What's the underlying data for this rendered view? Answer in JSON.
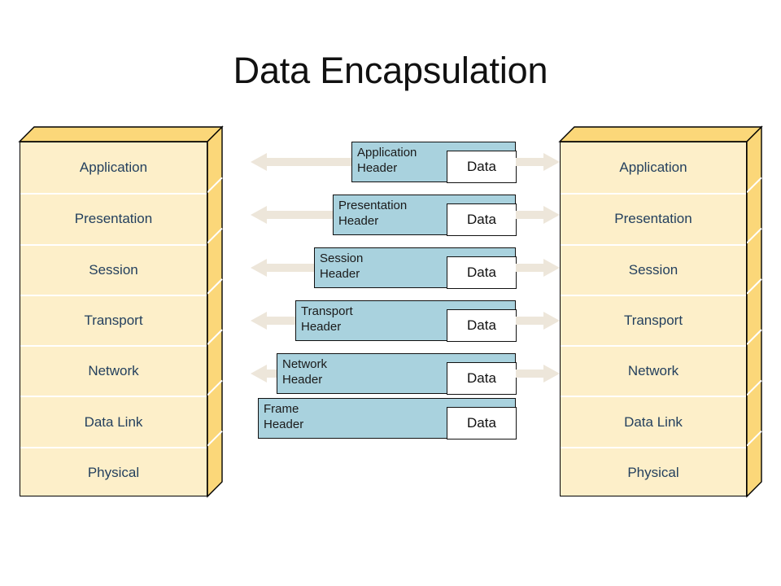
{
  "slide": {
    "title": "Data Encapsulation",
    "background_color": "#ffffff"
  },
  "colors": {
    "stack_front": "#FDEFC9",
    "stack_side": "#FBD779",
    "stack_text": "#24405E",
    "header_fill": "#A9D2DE",
    "header_border": "#111111",
    "data_fill": "#FFFFFF",
    "arrow": "#EDE6DA",
    "title_text": "#111111"
  },
  "left_stack": {
    "name": "sender-osi-stack",
    "layers": [
      {
        "label": "Application"
      },
      {
        "label": "Presentation"
      },
      {
        "label": "Session"
      },
      {
        "label": "Transport"
      },
      {
        "label": "Network"
      },
      {
        "label": "Data Link"
      },
      {
        "label": "Physical"
      }
    ]
  },
  "right_stack": {
    "name": "receiver-osi-stack",
    "layers": [
      {
        "label": "Application"
      },
      {
        "label": "Presentation"
      },
      {
        "label": "Session"
      },
      {
        "label": "Transport"
      },
      {
        "label": "Network"
      },
      {
        "label": "Data Link"
      },
      {
        "label": "Physical"
      }
    ]
  },
  "encapsulation_rows": [
    {
      "header_label": "Application\nHeader",
      "data_label": "Data",
      "has_left_arrow": true,
      "has_right_arrow": true
    },
    {
      "header_label": "Presentation\nHeader",
      "data_label": "Data",
      "has_left_arrow": true,
      "has_right_arrow": true
    },
    {
      "header_label": "Session\nHeader",
      "data_label": "Data",
      "has_left_arrow": true,
      "has_right_arrow": true
    },
    {
      "header_label": "Transport\nHeader",
      "data_label": "Data",
      "has_left_arrow": true,
      "has_right_arrow": true
    },
    {
      "header_label": "Network\nHeader",
      "data_label": "Data",
      "has_left_arrow": true,
      "has_right_arrow": true
    },
    {
      "header_label": "Frame\nHeader",
      "data_label": "Data",
      "has_left_arrow": false,
      "has_right_arrow": false
    }
  ]
}
